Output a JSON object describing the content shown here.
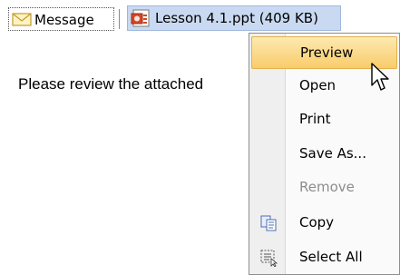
{
  "attachments": {
    "message_label": "Message",
    "file_label": "Lesson 4.1.ppt (409 KB)"
  },
  "body": {
    "text": "Please review the attached"
  },
  "menu": {
    "items": [
      {
        "label": "Preview",
        "icon": "none",
        "state": "highlighted"
      },
      {
        "label": "Open",
        "icon": "none",
        "state": "normal"
      },
      {
        "label": "Print",
        "icon": "none",
        "state": "normal"
      },
      {
        "label": "Save As...",
        "icon": "none",
        "state": "normal"
      },
      {
        "label": "Remove",
        "icon": "none",
        "state": "disabled"
      },
      {
        "label": "Copy",
        "icon": "copy-icon",
        "state": "normal"
      },
      {
        "label": "Select All",
        "icon": "select-all-icon",
        "state": "normal"
      }
    ]
  },
  "colors": {
    "highlight": "#f9cc6b",
    "attachment_selected": "#c9d9f1",
    "disabled_text": "#8d8d8d"
  }
}
